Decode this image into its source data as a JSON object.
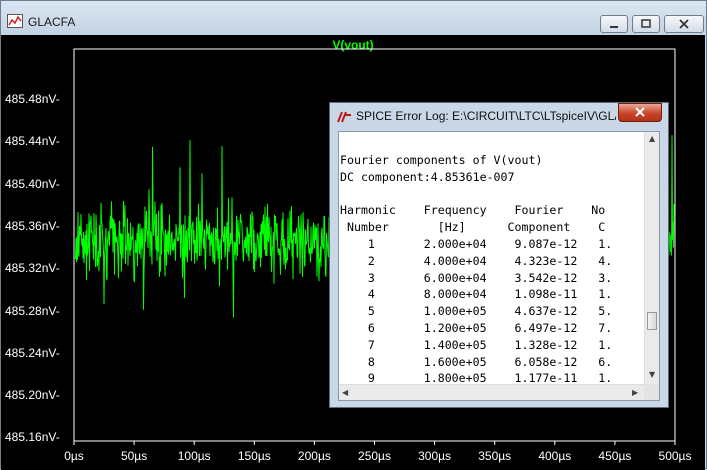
{
  "window": {
    "title": "GLACFA"
  },
  "plot": {
    "trace_title": "V(vout)",
    "y_ticks": [
      "485.48nV-",
      "485.44nV-",
      "485.40nV-",
      "485.36nV-",
      "485.32nV-",
      "485.28nV-",
      "485.24nV-",
      "485.20nV-",
      "485.16nV-"
    ],
    "x_ticks": [
      "0µs",
      "50µs",
      "100µs",
      "150µs",
      "200µs",
      "250µs",
      "300µs",
      "350µs",
      "400µs",
      "450µs",
      "500µs"
    ],
    "trace_color": "#00ff00",
    "background": "#000000"
  },
  "dialog": {
    "title": "SPICE Error Log: E:\\CIRCUIT\\LTC\\LTspiceIV\\GLA...",
    "log_lines": [
      "Fourier components of V(vout)",
      "DC component:4.85361e-007",
      "",
      "Harmonic    Frequency    Fourier    No",
      " Number       [Hz]      Component    C",
      "    1       2.000e+04    9.087e-12   1.",
      "    2       4.000e+04    4.323e-12   4.",
      "    3       6.000e+04    3.542e-12   3.",
      "    4       8.000e+04    1.098e-11   1.",
      "    5       1.000e+05    4.637e-12   5.",
      "    6       1.200e+05    6.497e-12   7.",
      "    7       1.400e+05    1.328e-12   1.",
      "    8       1.600e+05    6.058e-12   6.",
      "    9       1.800e+05    1.177e-11   1."
    ]
  }
}
